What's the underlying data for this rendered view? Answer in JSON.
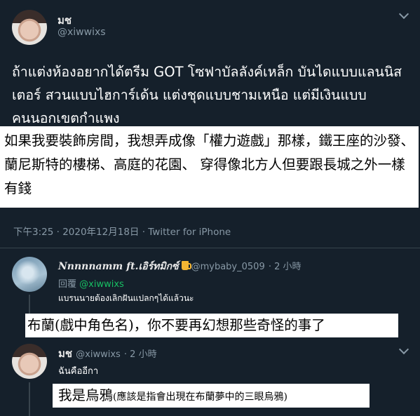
{
  "main_tweet": {
    "author_name": "มช",
    "author_handle": "@xiwwixs",
    "text": "ถ้าแต่งห้องอยากได้ตรีม GOT โซฟาบัลลังค์เหล็ก บันไดแบบแลนนิสเตอร์ สวนแบบไฮการ์เด้น แต่งชุดแบบชามเหนือ แต่มีเงินแบบคนนอกเขตกำแพง",
    "translation": "如果我要裝飾房間，我想弄成像「權力遊戲」那樣，鐵王座的沙發、蘭尼斯特的樓梯、高庭的花園、 穿得像北方人但要跟長城之外一樣有錢",
    "meta": "下午3:25 · 2020年12月18日 · Twitter for iPhone"
  },
  "replies": [
    {
      "author_name": "Nnnnnamm ft.เอิร์ทมิกซ์",
      "author_handle": "@mybaby_0509",
      "time": "· 2 小時",
      "reply_to_prefix": "回覆",
      "reply_to_handle": "@xiwwixs",
      "text": "แบรนนายต้องเลิกฝันแปลกๆได้แล้วนะ",
      "translation": "布蘭(戲中角色名)，你不要再幻想那些奇怪的事了"
    },
    {
      "author_name": "มช",
      "author_handle": "@xiwwixs",
      "time": "· 2 小時",
      "text": "ฉันคืออีกา",
      "translation_main": "我是烏鴉",
      "translation_note": "(應該是指會出現在布蘭夢中的三眼烏鴉)"
    }
  ],
  "icons": {
    "caret": "chevron-down-icon",
    "emoji": "beer-mug-emoji"
  },
  "colors": {
    "background": "#15202b",
    "text": "#ffffff",
    "secondary": "#8899a6",
    "link": "#17bf63",
    "overlay": "#ffffff"
  }
}
